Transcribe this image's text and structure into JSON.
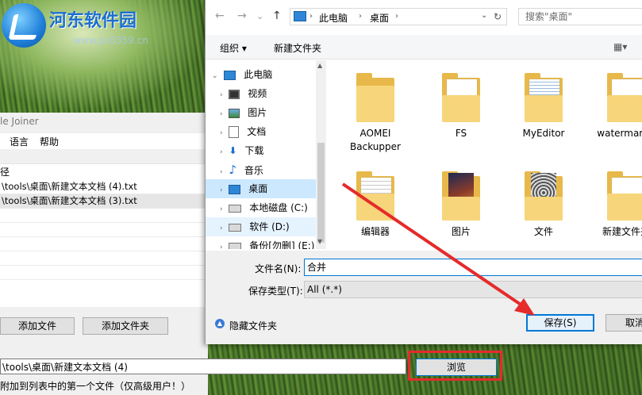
{
  "watermark": {
    "site": "河东软件园",
    "url": "www.pc0359.cn"
  },
  "app": {
    "title": "le Joiner",
    "menu": [
      "语言",
      "帮助"
    ],
    "list_header": "径",
    "rows": [
      "\\tools\\桌面\\新建文本文档 (4).txt",
      "\\tools\\桌面\\新建文本文档 (3).txt"
    ],
    "add_file_button": "添加文件",
    "add_folder_button": "添加文件夹",
    "output_path": "\\tools\\桌面\\新建文本文档 (4)",
    "browse_button": "浏览",
    "hint": "附加到列表中的第一个文件（仅高级用户！）"
  },
  "dialog": {
    "breadcrumb": [
      "此电脑",
      "桌面"
    ],
    "search_placeholder": "搜索\"桌面\"",
    "toolbar": {
      "organize": "组织 ▾",
      "new_folder": "新建文件夹"
    },
    "nav_items": [
      {
        "label": "此电脑",
        "icon": "computer-icon"
      },
      {
        "label": "视频",
        "icon": "video-icon"
      },
      {
        "label": "图片",
        "icon": "picture-icon"
      },
      {
        "label": "文档",
        "icon": "document-icon"
      },
      {
        "label": "下载",
        "icon": "download-icon"
      },
      {
        "label": "音乐",
        "icon": "music-icon"
      },
      {
        "label": "桌面",
        "icon": "desktop-icon"
      },
      {
        "label": "本地磁盘 (C:)",
        "icon": "drive-icon"
      },
      {
        "label": "软件 (D:)",
        "icon": "drive-icon"
      },
      {
        "label": "备份[勿删] (E:)",
        "icon": "drive-icon"
      }
    ],
    "folders": [
      "AOMEI Backupper",
      "FS",
      "MyEditor",
      "watermark t",
      "编辑器",
      "图片",
      "文件",
      "新建文件夹"
    ],
    "filename_label": "文件名(N):",
    "filename_value": "合并",
    "filetype_label": "保存类型(T):",
    "filetype_value": "All (*.*)",
    "hide_folders": "隐藏文件夹",
    "save_button": "保存(S)",
    "cancel_button": "取消"
  },
  "colors": {
    "accent": "#0078d7",
    "highlight_box": "#e52b2b",
    "selection": "#cce8ff"
  }
}
